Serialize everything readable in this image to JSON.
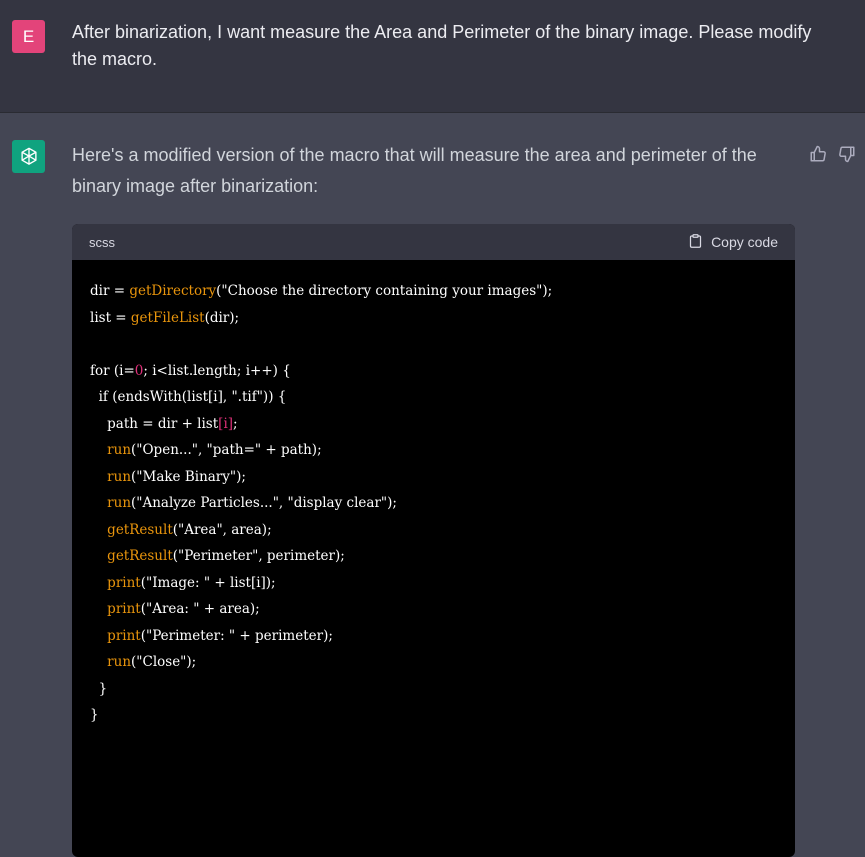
{
  "user": {
    "avatar": "E",
    "message": "After binarization, I want measure the Area and Perimeter of the binary image. Please modify the macro."
  },
  "assistant": {
    "intro": "Here's a modified version of the macro that will measure the area and perimeter of the binary image after binarization:",
    "icons": [
      "openai-logo-icon",
      "thumbs-up-icon",
      "thumbs-down-icon",
      "clipboard-icon"
    ],
    "code": {
      "language": "scss",
      "copy_label": "Copy code",
      "colors": {
        "function": "#e9950c",
        "number": "#df3079",
        "text": "#ffffff"
      },
      "lines": [
        [
          [
            "dir = ",
            "t"
          ],
          [
            "getDirectory",
            "f"
          ],
          [
            "(\"Choose the directory containing your images\");",
            "t"
          ]
        ],
        [
          [
            "list = ",
            "t"
          ],
          [
            "getFileList",
            "f"
          ],
          [
            "(dir);",
            "t"
          ]
        ],
        [],
        [
          [
            "for (i=",
            "t"
          ],
          [
            "0",
            "n"
          ],
          [
            "; i<list.length; i++) {",
            "t"
          ]
        ],
        [
          [
            "  if (endsWith(list[i], \".tif\")) {",
            "t"
          ]
        ],
        [
          [
            "    path = dir + list",
            "t"
          ],
          [
            "[i]",
            "n"
          ],
          [
            ";",
            "t"
          ]
        ],
        [
          [
            "    ",
            "t"
          ],
          [
            "run",
            "f"
          ],
          [
            "(\"Open...\", \"path=\" + path);",
            "t"
          ]
        ],
        [
          [
            "    ",
            "t"
          ],
          [
            "run",
            "f"
          ],
          [
            "(\"Make Binary\");",
            "t"
          ]
        ],
        [
          [
            "    ",
            "t"
          ],
          [
            "run",
            "f"
          ],
          [
            "(\"Analyze Particles...\", \"display clear\");",
            "t"
          ]
        ],
        [
          [
            "    ",
            "t"
          ],
          [
            "getResult",
            "f"
          ],
          [
            "(\"Area\", area);",
            "t"
          ]
        ],
        [
          [
            "    ",
            "t"
          ],
          [
            "getResult",
            "f"
          ],
          [
            "(\"Perimeter\", perimeter);",
            "t"
          ]
        ],
        [
          [
            "    ",
            "t"
          ],
          [
            "print",
            "f"
          ],
          [
            "(\"Image: \" + list[i]);",
            "t"
          ]
        ],
        [
          [
            "    ",
            "t"
          ],
          [
            "print",
            "f"
          ],
          [
            "(\"Area: \" + area);",
            "t"
          ]
        ],
        [
          [
            "    ",
            "t"
          ],
          [
            "print",
            "f"
          ],
          [
            "(\"Perimeter: \" + perimeter);",
            "t"
          ]
        ],
        [
          [
            "    ",
            "t"
          ],
          [
            "run",
            "f"
          ],
          [
            "(\"Close\");",
            "t"
          ]
        ],
        [
          [
            "  }",
            "t"
          ]
        ],
        [
          [
            "}",
            "t"
          ]
        ]
      ]
    }
  }
}
